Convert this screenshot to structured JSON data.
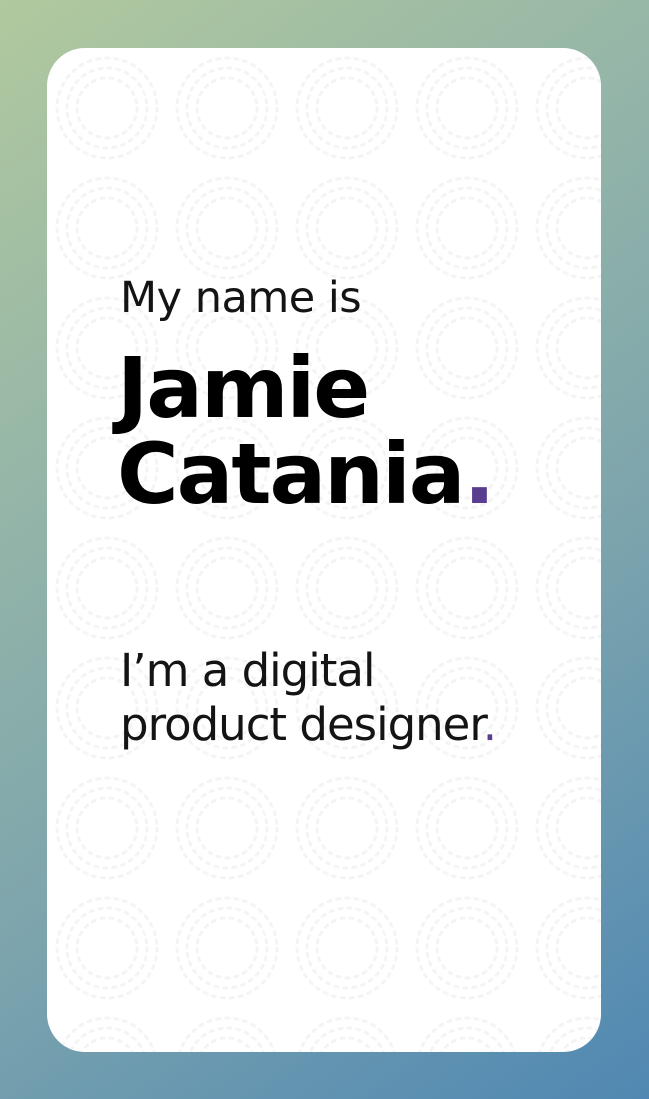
{
  "card": {
    "intro": "My name is",
    "name_first": "Jamie",
    "name_last": "Catania",
    "name_dot": ".",
    "tagline_line1": "I’m a digital",
    "tagline_line2": "product designer",
    "tagline_dot": "."
  },
  "colors": {
    "gradient_start": "#b1c99e",
    "gradient_end": "#5088b3",
    "accent": "#5a3d8f",
    "card": "#ffffff",
    "text": "#000000"
  }
}
